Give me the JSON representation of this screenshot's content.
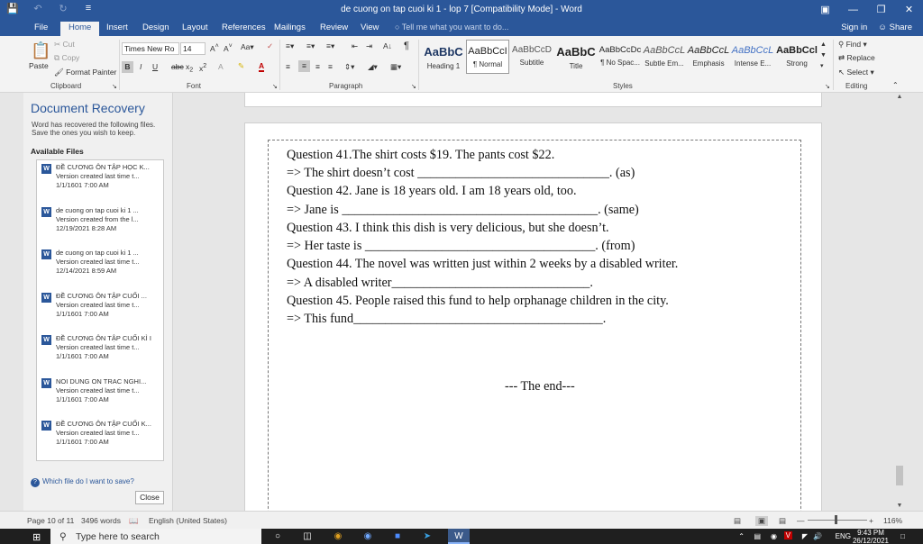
{
  "titlebar": {
    "title": "de cuong on tap cuoi ki 1 - lop 7 [Compatibility Mode] - Word",
    "save_icon": "save-icon",
    "undo_icon": "undo-icon",
    "redo_icon": "redo-icon",
    "customize_icon": "customize-qat-icon"
  },
  "tabs": [
    "File",
    "Home",
    "Insert",
    "Design",
    "Layout",
    "References",
    "Mailings",
    "Review",
    "View"
  ],
  "active_tab": "Home",
  "tell_me": "Tell me what you want to do...",
  "signin": "Sign in",
  "share": "Share",
  "ribbon": {
    "clipboard": {
      "paste": "Paste",
      "cut": "Cut",
      "copy": "Copy",
      "format_painter": "Format Painter",
      "label": "Clipboard"
    },
    "font": {
      "name": "Times New Ro",
      "size": "14",
      "label": "Font"
    },
    "paragraph": {
      "label": "Paragraph"
    },
    "styles": {
      "label": "Styles",
      "items": [
        {
          "sample": "AaBbC",
          "name": "Heading 1"
        },
        {
          "sample": "AaBbCcI",
          "name": "¶ Normal"
        },
        {
          "sample": "AaBbCcD",
          "name": "Subtitle"
        },
        {
          "sample": "AaBbC",
          "name": "Title"
        },
        {
          "sample": "AaBbCcDc",
          "name": "¶ No Spac..."
        },
        {
          "sample": "AaBbCcL",
          "name": "Subtle Em..."
        },
        {
          "sample": "AaBbCcL",
          "name": "Emphasis"
        },
        {
          "sample": "AaBbCcL",
          "name": "Intense E..."
        },
        {
          "sample": "AaBbCcl",
          "name": "Strong"
        }
      ]
    },
    "editing": {
      "find": "Find",
      "replace": "Replace",
      "select": "Select",
      "label": "Editing"
    }
  },
  "recovery": {
    "title": "Document Recovery",
    "description": "Word has recovered the following files. Save the ones you wish to keep.",
    "available": "Available Files",
    "files": [
      {
        "name": "ĐỀ CƯƠNG ÔN TẬP HỌC K...",
        "version": "Version created last time t...",
        "date": "1/1/1601 7:00 AM"
      },
      {
        "name": "de cuong on tap cuoi ki 1 ...",
        "version": "Version created from the l...",
        "date": "12/19/2021 8:28 AM"
      },
      {
        "name": "de cuong on tap cuoi ki 1 ...",
        "version": "Version created last time t...",
        "date": "12/14/2021 8:59 AM"
      },
      {
        "name": "ĐỀ CƯƠNG ÔN TẬP CUỐI ...",
        "version": "Version created last time t...",
        "date": "1/1/1601 7:00 AM"
      },
      {
        "name": "ĐỀ CƯƠNG ÔN TẬP CUỐI KÌ I",
        "version": "Version created last time t...",
        "date": "1/1/1601 7:00 AM"
      },
      {
        "name": "NOI DUNG ON TRAC NGHI...",
        "version": "Version created last time t...",
        "date": "1/1/1601 7:00 AM"
      },
      {
        "name": "ĐỀ CƯƠNG ÔN TẬP CUỐI K...",
        "version": "Version created last time t...",
        "date": "1/1/1601 7:00 AM"
      }
    ],
    "help": "Which file do I want to save?",
    "close": "Close"
  },
  "document": {
    "lines": [
      "Question 41.The shirt costs $19. The pants cost $22.",
      "=> The shirt doesn’t cost ______________________________. (as)",
      "Question 42. Jane is 18 years old. I am 18 years old, too.",
      "=> Jane is ________________________________________. (same)",
      "Question 43. I think this dish is very delicious, but she doesn’t.",
      "=> Her taste is ____________________________________. (from)",
      "Question 44. The novel was written just within 2 weeks by a disabled writer.",
      "=> A disabled writer_______________________________.",
      "Question 45. People raised this fund to help orphanage children in the city.",
      "=> This fund_______________________________________."
    ],
    "end": "--- The end---"
  },
  "status": {
    "page": "Page 10 of 11",
    "words": "3496 words",
    "language": "English (United States)",
    "zoom": "116%"
  },
  "taskbar": {
    "search": "Type here to search",
    "lang": "ENG",
    "time": "9:43 PM",
    "date": "26/12/2021"
  },
  "colors": {
    "word_blue": "#2b579a",
    "ribbon_bg": "#f3f3f3",
    "taskbar": "#1f1f1f"
  }
}
